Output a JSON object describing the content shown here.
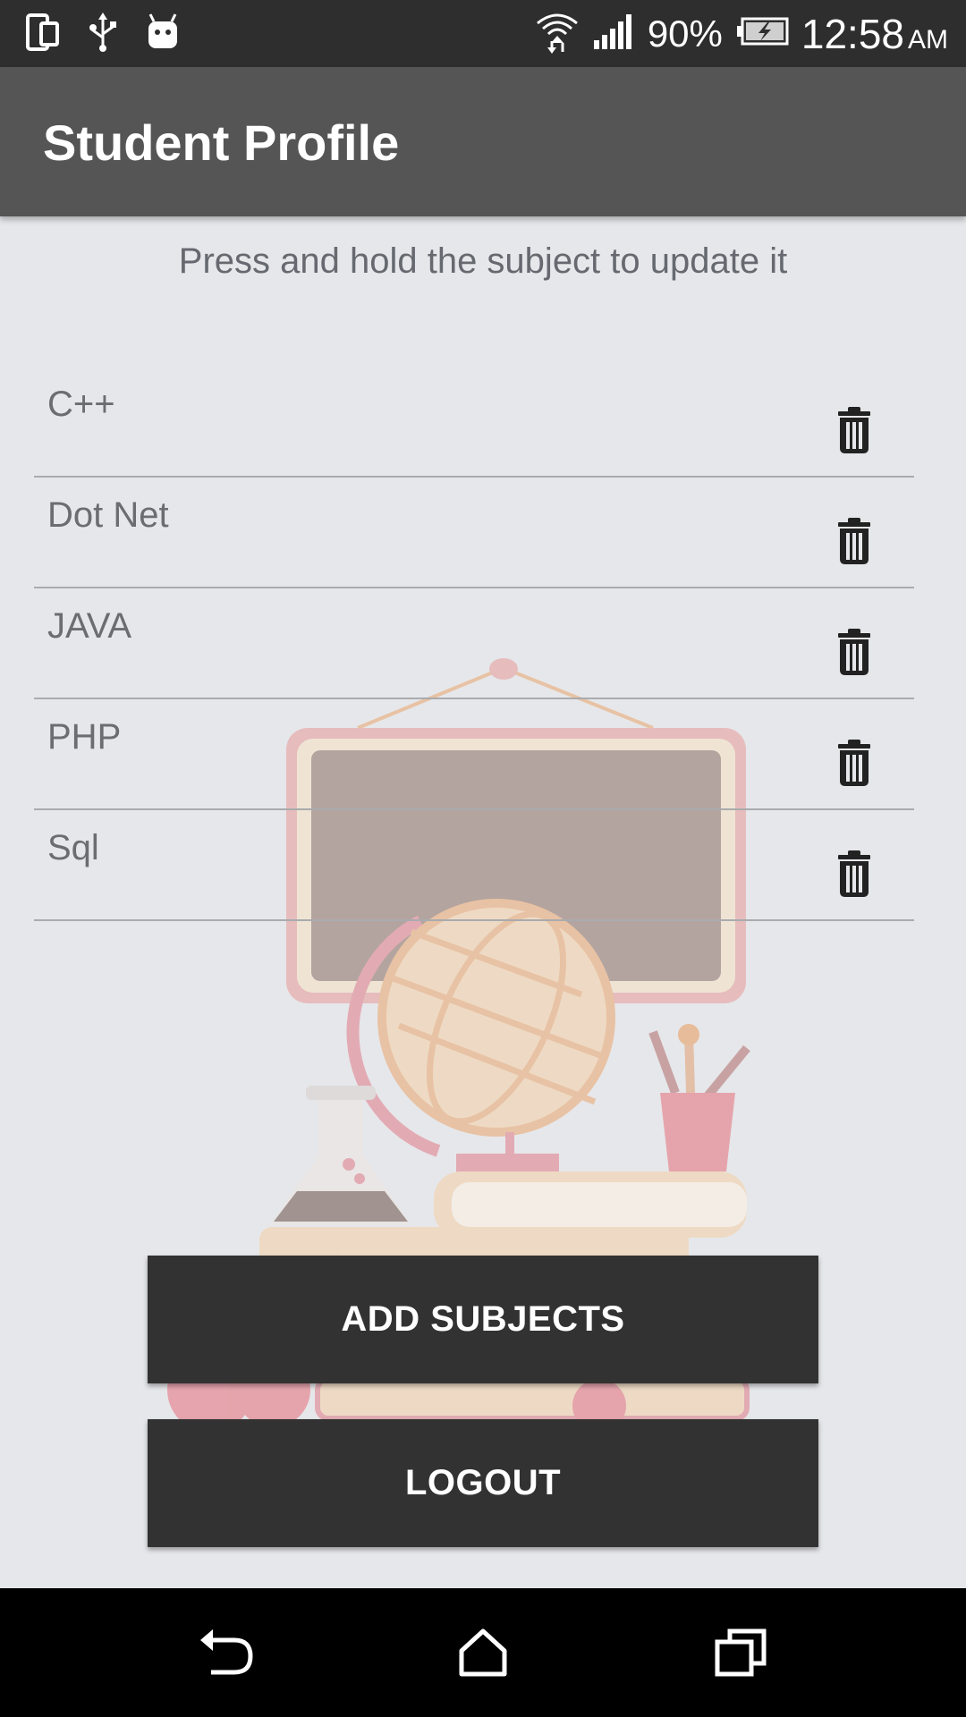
{
  "status_bar": {
    "battery": "90%",
    "time": "12:58",
    "ampm": "AM",
    "icons": [
      "screen-mirror-icon",
      "usb-icon",
      "android-icon",
      "wifi-icon",
      "signal-icon",
      "battery-charging-icon"
    ]
  },
  "app_bar": {
    "title": "Student Profile"
  },
  "main": {
    "hint": "Press and hold the subject to update it",
    "subjects": [
      {
        "name": "C++"
      },
      {
        "name": "Dot Net"
      },
      {
        "name": "JAVA"
      },
      {
        "name": "PHP"
      },
      {
        "name": "Sql"
      }
    ],
    "add_button": "ADD SUBJECTS",
    "logout_button": "LOGOUT"
  },
  "nav_bar": {
    "icons": [
      "back-icon",
      "home-icon",
      "recents-icon"
    ]
  },
  "colors": {
    "status_bar": "#2e2e2e",
    "app_bar": "#555555",
    "background": "#e6e7ea",
    "button": "#323232",
    "nav_bar": "#000000"
  }
}
